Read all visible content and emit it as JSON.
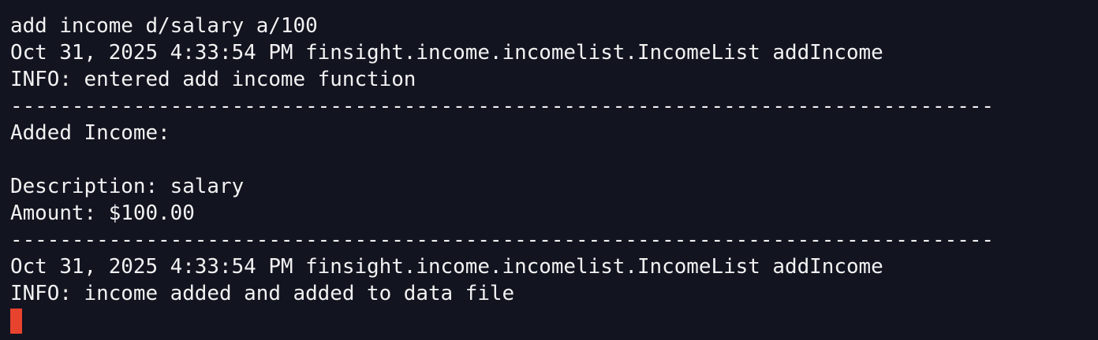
{
  "terminal": {
    "lines": [
      "add income d/salary a/100",
      "Oct 31, 2025 4:33:54 PM finsight.income.incomelist.IncomeList addIncome",
      "INFO: entered add income function",
      "--------------------------------------------------------------------------------",
      "Added Income:",
      "",
      "Description: salary",
      "Amount: $100.00",
      "--------------------------------------------------------------------------------",
      "Oct 31, 2025 4:33:54 PM finsight.income.incomelist.IncomeList addIncome",
      "INFO: income added and added to data file"
    ],
    "colors": {
      "background": "#121420",
      "text": "#f2f2f2",
      "cursor": "#e8432e"
    }
  }
}
